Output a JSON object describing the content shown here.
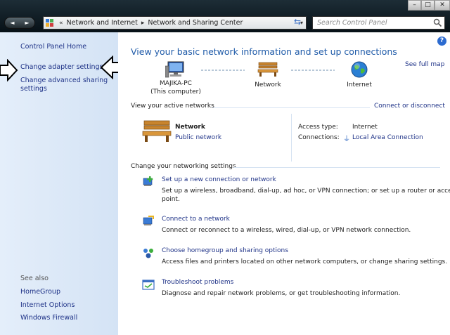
{
  "window": {
    "minimize": "–",
    "maximize": "□",
    "close": "✕"
  },
  "nav": {
    "back": "◄",
    "forward": "►"
  },
  "address": {
    "overflow": "«",
    "crumbs": [
      "Network and Internet",
      "Network and Sharing Center"
    ],
    "separator": "▸",
    "dropdown": "▾"
  },
  "search": {
    "placeholder": "Search Control Panel"
  },
  "sidebar": {
    "home": "Control Panel Home",
    "items": [
      "Change adapter settings",
      "Change advanced sharing",
      "settings"
    ],
    "see_also_label": "See also",
    "see_also": [
      "HomeGroup",
      "Internet Options",
      "Windows Firewall"
    ]
  },
  "main": {
    "help": "?",
    "title": "View your basic network information and set up connections",
    "see_full_map": "See full map",
    "map": {
      "computer": "MAJIKA-PC",
      "computer_sub": "(This computer)",
      "network": "Network",
      "internet": "Internet"
    },
    "active": {
      "header": "View your active networks",
      "connect_link": "Connect or disconnect",
      "network_name": "Network",
      "network_type": "Public network",
      "access_label": "Access type:",
      "access_value": "Internet",
      "connections_label": "Connections:",
      "connections_value": "Local Area Connection"
    },
    "change": {
      "header": "Change your networking settings",
      "tasks": [
        {
          "title": "Set up a new connection or network",
          "desc1": "Set up a wireless, broadband, dial-up, ad hoc, or VPN connection; or set up a router or access",
          "desc2": "point."
        },
        {
          "title": "Connect to a network",
          "desc1": "Connect or reconnect to a wireless, wired, dial-up, or VPN network connection."
        },
        {
          "title": "Choose homegroup and sharing options",
          "desc1": "Access files and printers located on other network computers, or change sharing settings."
        },
        {
          "title": "Troubleshoot problems",
          "desc1": "Diagnose and repair network problems, or get troubleshooting information."
        }
      ]
    }
  },
  "colors": {
    "link": "#1e3287",
    "heading": "#1e5aa8",
    "sidebar_bg": "#dce8f7"
  }
}
